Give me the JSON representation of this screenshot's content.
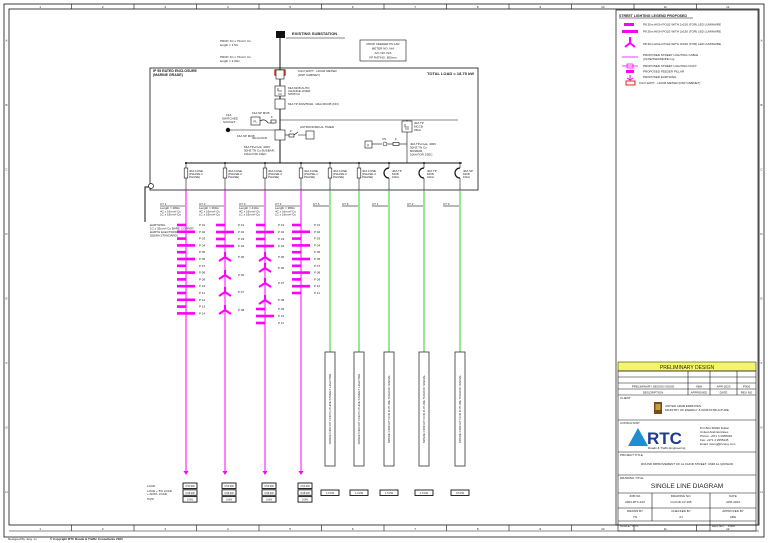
{
  "ruler": {
    "columns": [
      "1",
      "2",
      "3",
      "4",
      "5",
      "6",
      "7",
      "8",
      "9",
      "10",
      "11",
      "12"
    ],
    "rows": [
      "A",
      "B",
      "C",
      "D",
      "E",
      "F",
      "G",
      "H"
    ]
  },
  "substation": {
    "label": "EXISTING SUBSTATION"
  },
  "cable_in_1": {
    "line1": "PROP. 4C x 70mm² Cu",
    "line2": "length = 1.5m"
  },
  "cable_in_2": {
    "line1": "PROP. 4C x 70mm² Cu",
    "line2": "length = 2.00m"
  },
  "meter": {
    "line1": "KILO WATT - HOUR METER",
    "line2": "(DSP CABINET)"
  },
  "feeder_pillar": {
    "line1": "PROP. FEEDER PILLAR",
    "line2": "METER NO. N/A",
    "line3": "A/C NO. N/A",
    "line4": "FP RATING: 800mm"
  },
  "enclosure": {
    "title1": "IP 55 RATED ENCLOSURE",
    "title2": "(MARINE GRADE)",
    "total_load": "TOTAL LOAD = 18.75 kW"
  },
  "main_switch": {
    "line1": "63A MCB AUTO",
    "line2": "CHANGE-OVER",
    "line3": "SWITCH"
  },
  "contactor": {
    "label": "63A TP 400V/50Hz, 10kA MCCB (NO)"
  },
  "socket": {
    "line1": "13A",
    "line2": "SWITCHED",
    "line3": "SOCKET",
    "mcb": "16A SP MCB",
    "rcd": "30mA RCD"
  },
  "light": {
    "label": "PL",
    "fuse": "F"
  },
  "timer": {
    "label": "ASTRONOMICAL TIMER",
    "fuse": "F"
  },
  "busbar": {
    "line1": "63A TP+N+E, 400V",
    "line2": "50HZ TN Cu BUSBAR,",
    "line3": "10kA FOR 1SEC"
  },
  "right_mcb": {
    "line1": "40A TP",
    "line2": "MCCB",
    "line3": "25kA"
  },
  "voltmeter": {
    "label": "V",
    "switch": "VS",
    "fuse": "F"
  },
  "right_busbar": {
    "line1": "40A TP+N+E, 400V",
    "line2": "50HZ TN Cu",
    "line3": "BUSBAR,",
    "line4": "10kA FOR 1SEC"
  },
  "earth": {
    "line1": "EARTHING",
    "line2": "1C x 35mm² Cu BARE COPPER",
    "line3": "EARTH ELECTRODE",
    "line4": "(DEWA STANDARD)"
  },
  "circuits": [
    {
      "id": "CT 1",
      "breaker": [
        "40A FUSE",
        "(PHASE-1",
        "PHASE)"
      ],
      "cable": [
        "Length = 480m",
        "4C x 16mm² Cu",
        "1C x 16mm² Cu"
      ],
      "poles": [
        "P 01",
        "P 02",
        "P 03",
        "P 04",
        "P 05",
        "P 06",
        "P 07",
        "P 08",
        "P 09",
        "P 10",
        "P 11",
        "P 12",
        "P 13",
        "P 14"
      ],
      "load": "3.50 kW",
      "load_adj": "3.68 kW",
      "vd": "0.5%"
    },
    {
      "id": "CT 2",
      "breaker": [
        "40A FUSE",
        "(PHASE-2",
        "PHASE)"
      ],
      "cable": [
        "Length = 360m",
        "4C x 16mm² Cu",
        "1C x 16mm² Cu"
      ],
      "poles": [
        "P 01",
        "P 02",
        "P 03",
        "P 04",
        "P 05",
        "P 06",
        "P 07",
        "P 08"
      ],
      "load": "3.50 kW",
      "load_adj": "3.68 kW",
      "vd": "0.6%"
    },
    {
      "id": "CT 3",
      "breaker": [
        "40A FUSE",
        "(PHASE-3",
        "PHASE)"
      ],
      "cable": [
        "Length = 410m",
        "4C x 16mm² Cu",
        "1C x 16mm² Cu"
      ],
      "poles": [
        "P 01",
        "P 02",
        "P 03",
        "P 04",
        "P 05",
        "P 06",
        "P 07",
        "P 08",
        "P 09",
        "P 10",
        "P 11"
      ],
      "load": "3.50 kW",
      "load_adj": "3.68 kW",
      "vd": "0.6%"
    },
    {
      "id": "CT 4",
      "breaker": [
        "40A FUSE",
        "(PHASE-1",
        "PHASE)"
      ],
      "cable": [
        "Length = 380m",
        "4C x 16mm² Cu",
        "1C x 16mm² Cu"
      ],
      "poles": [
        "P 01",
        "P 02",
        "P 03",
        "P 04",
        "P 05",
        "P 06",
        "P 07",
        "P 08",
        "P 09",
        "P 10",
        "P 11"
      ],
      "load": "3.50 kW",
      "load_adj": "3.68 kW",
      "vd": "0.5%"
    }
  ],
  "spares": [
    {
      "id": "CT 5",
      "breaker": [
        "40A FUSE",
        "(PHASE-2",
        "PHASE)"
      ],
      "label": "SPARE CIRCUIT FOR FUTURE STREET LIGHTING",
      "load": "1.0 kW"
    },
    {
      "id": "CT 6",
      "breaker": [
        "40A FUSE",
        "(PHASE-3",
        "PHASE)"
      ],
      "label": "SPARE CIRCUIT FOR FUTURE STREET LIGHTING",
      "load": "1.0 kW"
    },
    {
      "id": "CT 1",
      "breaker": [
        "40A TP",
        "MCB",
        "10kA"
      ],
      "label": "SPARE CIRCUIT FOR FUTURE TRAFFIC SIGNAL",
      "load": "1.5 kW"
    },
    {
      "id": "CT 2",
      "breaker": [
        "40A TP",
        "MCB",
        "10kA"
      ],
      "label": "SPARE CIRCUIT FOR FUTURE TRAFFIC SIGNAL",
      "load": "1.5 kW"
    },
    {
      "id": "CT 3",
      "breaker": [
        "40A SP",
        "MCB",
        "10kA"
      ],
      "label": "SPARE CIRCUIT FOR FUTURE TRAFFIC SIGNAL",
      "load": "0.5 kW"
    }
  ],
  "load_labels": {
    "load": "LOAD",
    "load_adj": "LOAD + 5% LOAD",
    "load_adj2": "+ ADD'L LOAD",
    "vd": "%VD"
  },
  "legend": {
    "title": "STREET LIGHTING LEGEND PROPOSED",
    "items": [
      "P8.30m HIGH POLE WITH 1x150 (TOR) LED LUMINAIRE",
      "P8.30m HIGH POLE WITH 2x150 (TOR) LED LUMINAIRE",
      "P8.30m HIGH POLE WITH 3x150 (TOR) LED LUMINAIRE",
      "PROPOSED STREET LIGHTING CABLE",
      "(XLPE/SWA/MDPE Cu)",
      "PROPOSED STREET LIGHTING DUCT",
      "PROPOSED FEEDER PILLAR",
      "PROPOSED EARTHING",
      "KILO WATT - HOUR METER (DSP CABINET)"
    ]
  },
  "title_block": {
    "banner": "PRELIMINARY DESIGN",
    "rev_row": {
      "description": "PRELIMINARY DESIGN ISSUE",
      "approved": "ABH",
      "date": "APR-2023",
      "rev": "P000"
    },
    "rev_header": {
      "description": "DESCRIPTION",
      "approved": "APPROVED",
      "date": "DATE",
      "rev": "REV NO"
    },
    "client_label": "CLIENT",
    "client_name1": "UNITED ARAB EMIRATES",
    "client_name2": "MINISTRY OF ENERGY & INFRASTRUCTURE",
    "consultant_label": "CONSULTANT",
    "consultant_logo": "RTC",
    "consultant_tagline": "Roads & Traffic Engineering",
    "consultant_address": [
      "P.O.Box 60020 Dubai",
      "United Arab Emirates",
      "Phone: +971 4 2955040",
      "Fax: +971 4 2955445",
      "Email: rtceng@rtceng.com"
    ],
    "project_label": "PROJECT TITLE",
    "project_title": "ROUND IMPROVEMENT OF AL KHOR STREET, UMM AL QAIWAIN",
    "drawing_label": "DRAWING TITLE",
    "drawing_title": "SINGLE LINE DIAGRAM",
    "job_label": "JOB NO.",
    "job_value": "2303-RTC-120",
    "drawing_no_label": "DRAWING NO.",
    "drawing_no_value": "CLOUD-LP-105",
    "date_label": "DATE",
    "date_value": "APR-2023",
    "drawn_label": "DRAWN BY",
    "drawn_value": "TN",
    "checked_label": "CHECKED BY",
    "checked_value": "AJ",
    "approved_label": "APPROVED BY",
    "approved_value": "ABH",
    "scale_label": "SCALE : NTS",
    "rev_label": "REV NO.",
    "rev_value": "P000"
  },
  "footer": {
    "left": "Designed By: Eng. xx",
    "center": "© Copyright RTC Roads & Traffic Consultants 2023"
  },
  "colors": {
    "lighting": "#ff00ff",
    "spare": "#33cc33",
    "meter": "#e02020",
    "banner": "#f5f56a"
  }
}
